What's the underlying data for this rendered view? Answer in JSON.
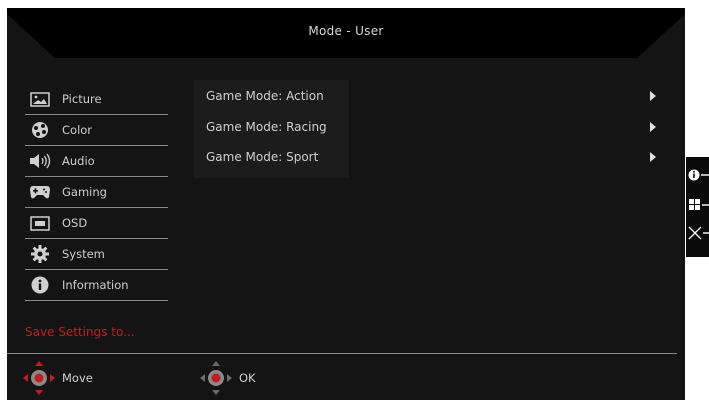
{
  "header": {
    "title": "Mode - User"
  },
  "sidebar": {
    "items": [
      {
        "label": "Picture",
        "icon": "picture-icon"
      },
      {
        "label": "Color",
        "icon": "palette-icon"
      },
      {
        "label": "Audio",
        "icon": "speaker-icon"
      },
      {
        "label": "Gaming",
        "icon": "gamepad-icon"
      },
      {
        "label": "OSD",
        "icon": "osd-icon"
      },
      {
        "label": "System",
        "icon": "gear-icon"
      },
      {
        "label": "Information",
        "icon": "info-icon"
      }
    ],
    "save_label": "Save Settings to..."
  },
  "main": {
    "options": [
      {
        "label": "Game Mode: Action"
      },
      {
        "label": "Game Mode: Racing"
      },
      {
        "label": "Game Mode: Sport"
      }
    ]
  },
  "footer": {
    "move_label": "Move",
    "ok_label": "OK"
  },
  "colors": {
    "background": "#141414",
    "accent_red": "#c61b1b",
    "text": "#cfcfcf"
  }
}
